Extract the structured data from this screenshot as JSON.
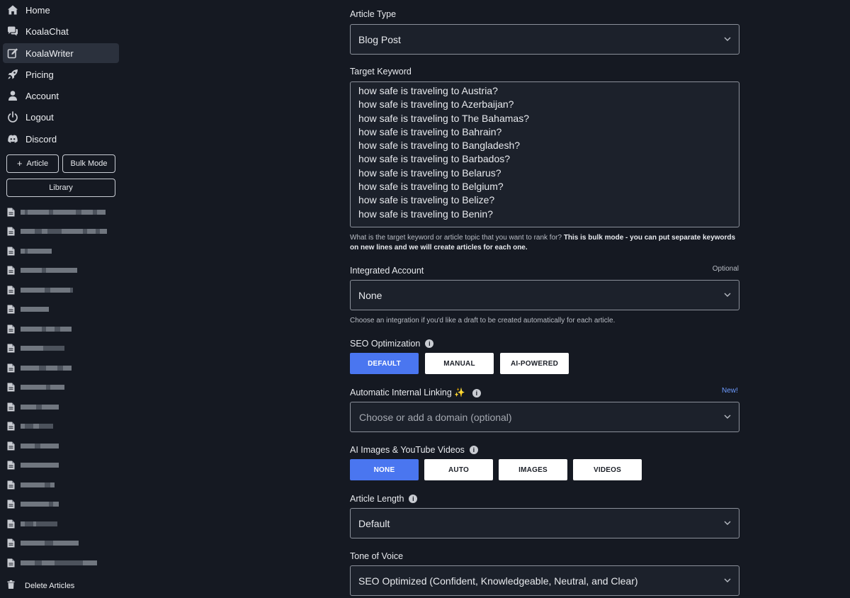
{
  "sidebar": {
    "nav": [
      {
        "label": "Home",
        "icon": "home-icon"
      },
      {
        "label": "KoalaChat",
        "icon": "chat-icon"
      },
      {
        "label": "KoalaWriter",
        "icon": "edit-icon",
        "active": true
      },
      {
        "label": "Pricing",
        "icon": "rocket-icon"
      },
      {
        "label": "Account",
        "icon": "user-icon"
      },
      {
        "label": "Logout",
        "icon": "power-icon"
      },
      {
        "label": "Discord",
        "icon": "discord-icon"
      }
    ],
    "article_button": "Article",
    "bulk_button": "Bulk Mode",
    "library_button": "Library",
    "delete_label": "Delete Articles"
  },
  "form": {
    "article_type": {
      "label": "Article Type",
      "value": "Blog Post"
    },
    "target_keyword": {
      "label": "Target Keyword",
      "lines": [
        "how safe is traveling to Austria?",
        "how safe is traveling to Azerbaijan?",
        "how safe is traveling to The Bahamas?",
        "how safe is traveling to Bahrain?",
        "how safe is traveling to Bangladesh?",
        "how safe is traveling to Barbados?",
        "how safe is traveling to Belarus?",
        "how safe is traveling to Belgium?",
        "how safe is traveling to Belize?",
        "how safe is traveling to Benin?"
      ],
      "help": "What is the target keyword or article topic that you want to rank for?",
      "help_bold": "This is bulk mode - you can put separate keywords on new lines and we will create articles for each one."
    },
    "integrated_account": {
      "label": "Integrated Account",
      "optional": "Optional",
      "value": "None",
      "help": "Choose an integration if you'd like a draft to be created automatically for each article."
    },
    "seo": {
      "label": "SEO Optimization",
      "options": [
        "DEFAULT",
        "MANUAL",
        "AI-POWERED"
      ],
      "selected": "DEFAULT"
    },
    "linking": {
      "label": "Automatic Internal Linking ✨",
      "badge": "New!",
      "placeholder": "Choose or add a domain (optional)"
    },
    "media": {
      "label": "AI Images & YouTube Videos",
      "options": [
        "NONE",
        "AUTO",
        "IMAGES",
        "VIDEOS"
      ],
      "selected": "NONE"
    },
    "length": {
      "label": "Article Length",
      "value": "Default"
    },
    "tone": {
      "label": "Tone of Voice",
      "value": "SEO Optimized (Confident, Knowledgeable, Neutral, and Clear)"
    }
  },
  "colors": {
    "accent": "#4a76f0",
    "background": "#151922",
    "field": "#1c212b",
    "badge": "#6d9bff"
  }
}
